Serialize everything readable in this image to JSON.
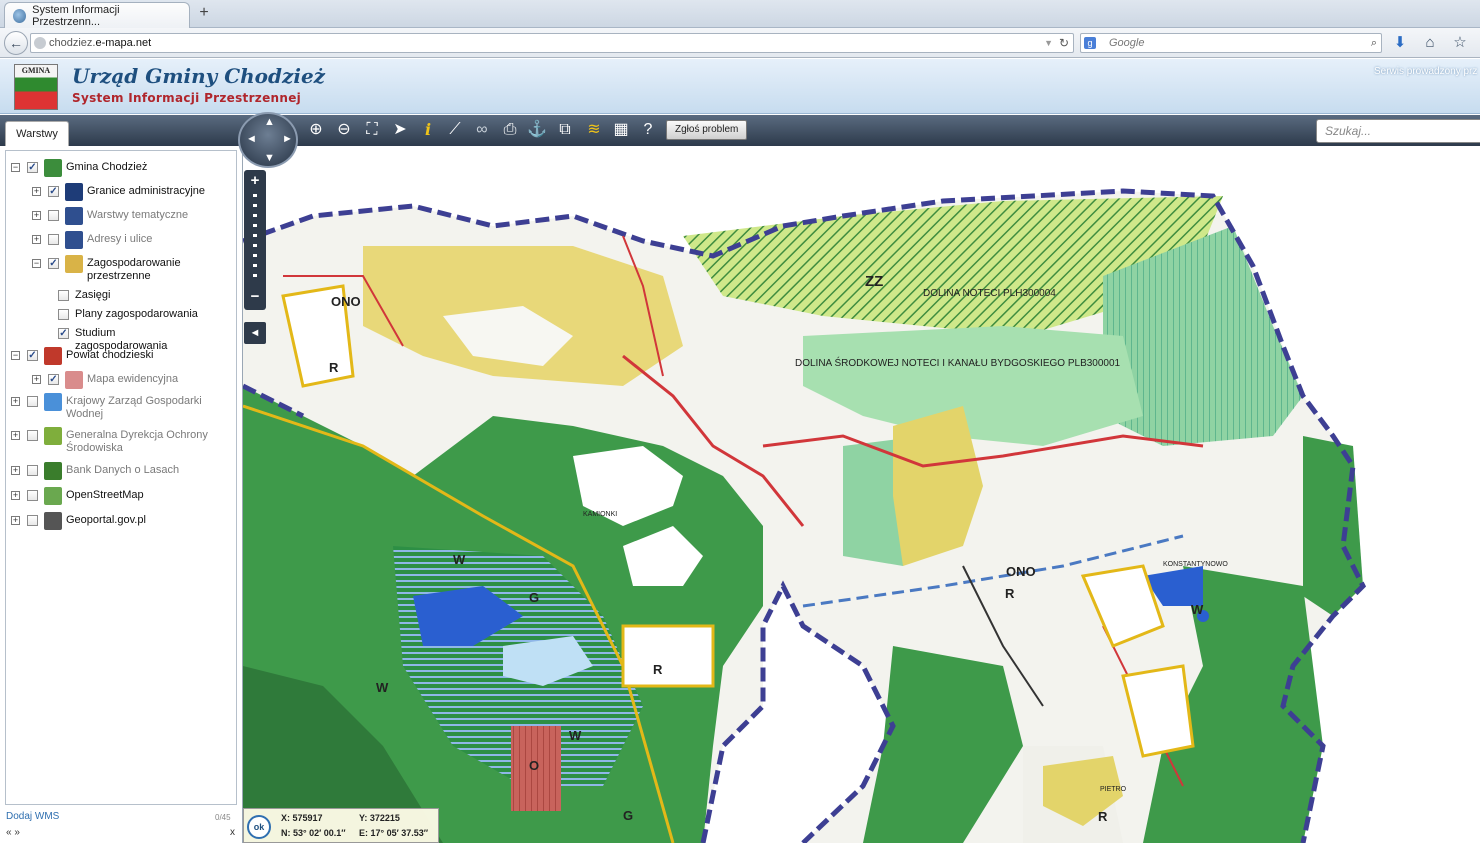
{
  "browser": {
    "tab_title": "System Informacji Przestrzenn...",
    "new_tab": "+",
    "url_prefix": "chodziez.",
    "url_host": "e-mapa.net",
    "search_placeholder": "Google",
    "search_engine_icon": "g",
    "icons": [
      "back-arrow-icon",
      "globe-icon",
      "reload-icon",
      "search-icon",
      "download-icon",
      "home-icon",
      "star-icon"
    ]
  },
  "header": {
    "logo_text": "GMINA",
    "title": "Urząd Gminy Chodzież",
    "subtitle": "System Informacji Przestrzennej",
    "service_info": "Serwis prowadzony prz"
  },
  "toolbar": {
    "panel_tab": "Warstwy",
    "report_button": "Zgłoś problem",
    "search_placeholder": "Szukaj...",
    "tools": [
      "zoom-in",
      "zoom-out",
      "zoom-extent",
      "select",
      "info",
      "measure",
      "link",
      "print",
      "route",
      "copy",
      "layers",
      "layout",
      "help"
    ]
  },
  "layers": [
    {
      "label": "Gmina Chodzież",
      "checked": true,
      "expander": "−",
      "indent": 0,
      "muted": false,
      "icon_color": "#3c8d3c"
    },
    {
      "label": "Granice administracyjne",
      "checked": true,
      "expander": "+",
      "indent": 1,
      "muted": false,
      "icon_color": "#1e3c78"
    },
    {
      "label": "Warstwy tematyczne",
      "checked": false,
      "expander": "+",
      "indent": 1,
      "muted": true,
      "icon_color": "#2f4f8f"
    },
    {
      "label": "Adresy i ulice",
      "checked": false,
      "expander": "+",
      "indent": 1,
      "muted": true,
      "icon_color": "#2f4f8f"
    },
    {
      "label": "Zagospodarowanie przestrzenne",
      "checked": true,
      "expander": "−",
      "indent": 1,
      "muted": false,
      "icon_color": "#d9b347"
    },
    {
      "label": "Zasięgi",
      "checked": false,
      "expander": "",
      "indent": 2,
      "muted": false,
      "icon_color": ""
    },
    {
      "label": "Plany zagospodarowania",
      "checked": false,
      "expander": "",
      "indent": 2,
      "muted": false,
      "icon_color": ""
    },
    {
      "label": "Studium zagospodarowania",
      "checked": true,
      "expander": "",
      "indent": 2,
      "muted": false,
      "icon_color": ""
    },
    {
      "label": "Powiat chodzieski",
      "checked": true,
      "expander": "−",
      "indent": 0,
      "muted": false,
      "icon_color": "#c0392b"
    },
    {
      "label": "Mapa ewidencyjna",
      "checked": true,
      "expander": "+",
      "indent": 1,
      "muted": true,
      "icon_color": "#d98c8c"
    },
    {
      "label": "Krajowy Zarząd Gospodarki Wodnej",
      "checked": false,
      "expander": "+",
      "indent": 0,
      "muted": true,
      "icon_color": "#4a90d9"
    },
    {
      "label": "Generalna Dyrekcja Ochrony Środowiska",
      "checked": false,
      "expander": "+",
      "indent": 0,
      "muted": true,
      "icon_color": "#7fae3c"
    },
    {
      "label": "Bank Danych o Lasach",
      "checked": false,
      "expander": "+",
      "indent": 0,
      "muted": true,
      "icon_color": "#3a7d2c"
    },
    {
      "label": "OpenStreetMap",
      "checked": false,
      "expander": "+",
      "indent": 0,
      "muted": false,
      "icon_color": "#6aa84f"
    },
    {
      "label": "Geoportal.gov.pl",
      "checked": false,
      "expander": "+",
      "indent": 0,
      "muted": false,
      "icon_color": "#555555"
    }
  ],
  "sidebar_footer": {
    "add_wms": "Dodaj WMS",
    "counter": "0/45",
    "collapse": "« »",
    "close": "x"
  },
  "map": {
    "labels": [
      "ZZ",
      "DOLINA NOTECI PLH300004",
      "DOLINA ŚRODKOWEJ NOTECI I KANAŁU BYDGOSKIEGO PLB300001",
      "ONO",
      "R",
      "W",
      "G",
      "O",
      "KAMIONKI",
      "KONSTANTYNOWO",
      "PIETRO"
    ],
    "colors": {
      "forest": "#3e9a4a",
      "forest_dark": "#2f7a3a",
      "meadow": "#9bd79b",
      "agriculture": "#f4f4ef",
      "yellow_zone": "#e3d46a",
      "water": "#2a5fd0",
      "boundary": "#3d3f93",
      "road_main": "#d1363a",
      "road_secondary": "#e3b818"
    }
  },
  "navigation": {
    "pan_up": "▲",
    "pan_down": "▼",
    "pan_left": "◄",
    "pan_right": "►",
    "zoom_in": "+",
    "zoom_out": "−",
    "panel_toggle": "◄"
  },
  "coordinates": {
    "ok": "ok",
    "x": "X: 575917",
    "y": "Y: 372215",
    "n": "N: 53° 02′ 00.1″",
    "e": "E: 17° 05′ 37.53″"
  }
}
